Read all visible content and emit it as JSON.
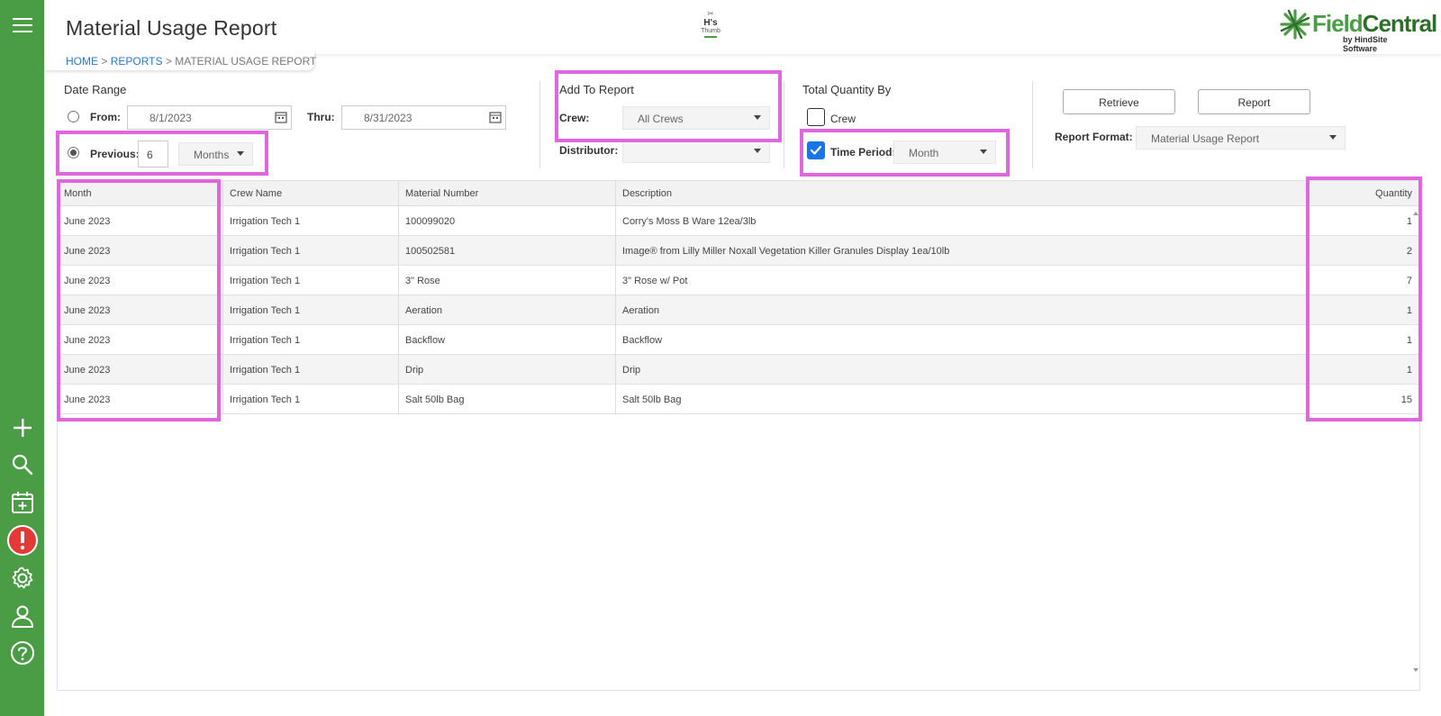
{
  "header": {
    "title": "Material Usage Report",
    "center_logo": {
      "line1": "H's",
      "line2": "Thumb"
    },
    "brand": {
      "name_light": "Field",
      "name_dark": "Central",
      "sub": "by HindSite Software"
    }
  },
  "breadcrumb": {
    "home": "HOME",
    "sep1": ">",
    "reports": "REPORTS",
    "sep2": ">",
    "current": "MATERIAL USAGE REPORT"
  },
  "sidebar": {
    "icons": [
      "menu-icon",
      "plus-icon",
      "search-icon",
      "calendar-add-icon",
      "alert-icon",
      "gear-icon",
      "user-icon",
      "help-icon"
    ]
  },
  "date_range": {
    "title": "Date Range",
    "from_label": "From:",
    "from_value": "8/1/2023",
    "thru_label": "Thru:",
    "thru_value": "8/31/2023",
    "previous_label": "Previous:",
    "previous_value": "6",
    "previous_unit": "Months",
    "selected": "previous"
  },
  "add_to_report": {
    "title": "Add To Report",
    "crew_label": "Crew:",
    "crew_value": "All Crews",
    "distributor_label": "Distributor:",
    "distributor_value": ""
  },
  "total_quantity_by": {
    "title": "Total Quantity By",
    "crew_label": "Crew",
    "crew_checked": false,
    "time_period_label": "Time Period:",
    "time_period_checked": true,
    "time_period_value": "Month"
  },
  "actions": {
    "retrieve": "Retrieve",
    "report": "Report",
    "report_format_label": "Report Format:",
    "report_format_value": "Material Usage Report"
  },
  "table": {
    "columns": [
      "Month",
      "Crew Name",
      "Material Number",
      "Description",
      "Quantity"
    ],
    "rows": [
      [
        "June 2023",
        "Irrigation Tech 1",
        "100099020",
        "Corry's Moss B Ware 12ea/3lb",
        "1"
      ],
      [
        "June 2023",
        "Irrigation Tech 1",
        "100502581",
        "Image® from Lilly Miller Noxall Vegetation Killer Granules Display 1ea/10lb",
        "2"
      ],
      [
        "June 2023",
        "Irrigation Tech 1",
        "3\" Rose",
        "3\" Rose w/ Pot",
        "7"
      ],
      [
        "June 2023",
        "Irrigation Tech 1",
        "Aeration",
        "Aeration",
        "1"
      ],
      [
        "June 2023",
        "Irrigation Tech 1",
        "Backflow",
        "Backflow",
        "1"
      ],
      [
        "June 2023",
        "Irrigation Tech 1",
        "Drip",
        "Drip",
        "1"
      ],
      [
        "June 2023",
        "Irrigation Tech 1",
        "Salt 50lb Bag",
        "Salt 50lb Bag",
        "15"
      ]
    ]
  },
  "colors": {
    "sidebar": "#4a9c45",
    "highlight": "#e066e0",
    "link": "#2b78c2",
    "checkbox": "#1a73e8",
    "alert": "#e53935"
  }
}
